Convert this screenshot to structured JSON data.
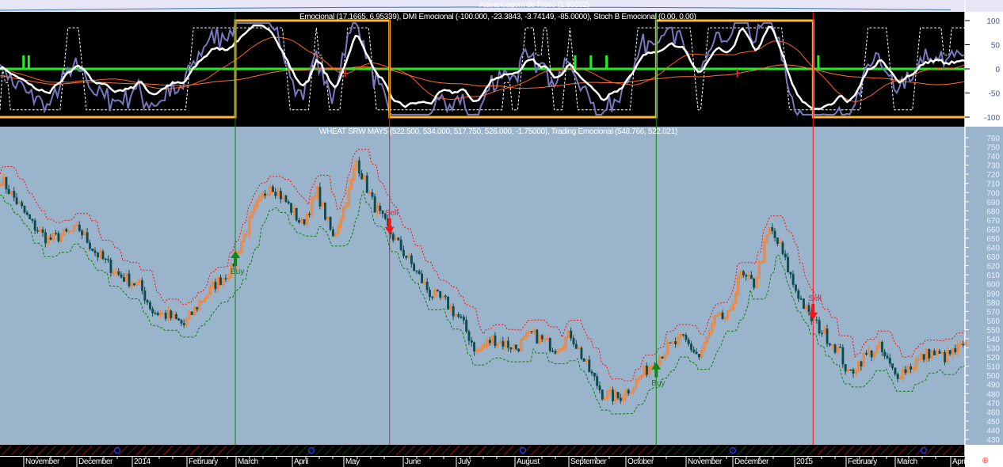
{
  "panes": {
    "risk_title": "Alavancagem de Risco (1.85532)",
    "indicator_title": "Emocional (17.1665, 6.95339), DMI Emocional (-100.000, -23.3843, -3.74149, -85.0000), Stoch B Emocional (0.00, 0.00)",
    "price_title": "WHEAT SRW MAY5 (522.500, 534.000, 517.750, 526.000, -1.75000), Trading Emocional (548.766, 522.021)"
  },
  "colors": {
    "price_bg": "#9ab4cc",
    "indicator_bg": "#000000",
    "risk_bg": "#e6e6f6",
    "up_candle": "#ff7f27",
    "down_candle": "#0d4b4f",
    "state_line": "#ffb734",
    "zero_line": "#22ee22",
    "buy": "#118811",
    "sell": "#ff1111"
  },
  "signals": [
    {
      "type": "buy",
      "label": "Buy",
      "bar": 90
    },
    {
      "type": "sell",
      "label": "Sell",
      "bar": 149
    },
    {
      "type": "buy",
      "label": "Buy",
      "bar": 251
    },
    {
      "type": "sell",
      "label": "Sell",
      "bar": 311
    }
  ],
  "axis": {
    "months": [
      "November",
      "December",
      "2014",
      "February",
      "March",
      "April",
      "May",
      "June",
      "July",
      "August",
      "September",
      "October",
      "November",
      "December",
      "2015",
      "February",
      "March",
      "April"
    ],
    "indicator_ticks": [
      "100",
      "50",
      "0",
      "-50",
      "-100"
    ]
  },
  "chart_data": [
    {
      "type": "line",
      "title": "Alavancagem de Risco (1.85532)",
      "value": 1.85532
    },
    {
      "type": "line",
      "title": "Emocional / DMI Emocional / Stoch B Emocional",
      "ylim": [
        -100,
        100
      ],
      "state_series": [
        [
          0,
          -100
        ],
        [
          90,
          100
        ],
        [
          149,
          -100
        ],
        [
          251,
          100
        ],
        [
          311,
          -100
        ],
        [
          369,
          -100
        ]
      ],
      "green_spikes": [
        9,
        11,
        220,
        226,
        232,
        313
      ],
      "red_spikes": [
        132,
        282
      ]
    },
    {
      "type": "candlestick",
      "title": "WHEAT SRW MAY5",
      "ylim": [
        430,
        760
      ],
      "ylabel": "",
      "yticks": [
        430,
        440,
        450,
        460,
        470,
        480,
        490,
        500,
        510,
        520,
        530,
        540,
        550,
        560,
        570,
        580,
        590,
        600,
        610,
        620,
        630,
        640,
        650,
        660,
        670,
        680,
        690,
        700,
        710,
        720,
        730,
        740,
        750,
        760
      ],
      "close_keypoints": [
        [
          0,
          715
        ],
        [
          6,
          690
        ],
        [
          12,
          665
        ],
        [
          18,
          648
        ],
        [
          30,
          660
        ],
        [
          36,
          635
        ],
        [
          45,
          610
        ],
        [
          53,
          598
        ],
        [
          58,
          570
        ],
        [
          64,
          565
        ],
        [
          70,
          555
        ],
        [
          76,
          580
        ],
        [
          82,
          600
        ],
        [
          88,
          615
        ],
        [
          91,
          640
        ],
        [
          97,
          680
        ],
        [
          103,
          710
        ],
        [
          109,
          690
        ],
        [
          115,
          665
        ],
        [
          121,
          700
        ],
        [
          127,
          650
        ],
        [
          133,
          700
        ],
        [
          136,
          735
        ],
        [
          142,
          690
        ],
        [
          148,
          660
        ],
        [
          155,
          630
        ],
        [
          164,
          590
        ],
        [
          170,
          580
        ],
        [
          176,
          560
        ],
        [
          182,
          525
        ],
        [
          188,
          540
        ],
        [
          197,
          530
        ],
        [
          203,
          545
        ],
        [
          212,
          530
        ],
        [
          218,
          545
        ],
        [
          224,
          510
        ],
        [
          230,
          480
        ],
        [
          236,
          475
        ],
        [
          242,
          490
        ],
        [
          248,
          510
        ],
        [
          255,
          530
        ],
        [
          261,
          540
        ],
        [
          267,
          520
        ],
        [
          273,
          560
        ],
        [
          279,
          565
        ],
        [
          282,
          610
        ],
        [
          288,
          600
        ],
        [
          294,
          660
        ],
        [
          298,
          640
        ],
        [
          303,
          600
        ],
        [
          309,
          565
        ],
        [
          315,
          545
        ],
        [
          321,
          525
        ],
        [
          324,
          500
        ],
        [
          330,
          520
        ],
        [
          336,
          530
        ],
        [
          342,
          500
        ],
        [
          348,
          510
        ],
        [
          355,
          525
        ],
        [
          361,
          520
        ],
        [
          367,
          530
        ]
      ],
      "last": {
        "open": 522.5,
        "high": 534.0,
        "low": 517.75,
        "close": 526.0,
        "change": -1.75
      },
      "trading_emocional": [
        548.766,
        522.021
      ]
    }
  ]
}
